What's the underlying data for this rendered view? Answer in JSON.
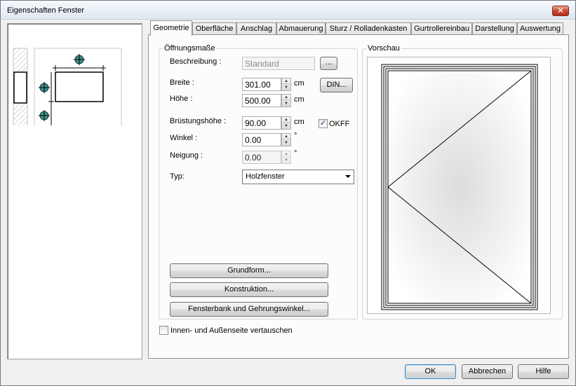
{
  "window": {
    "title": "Eigenschaften Fenster",
    "close_glyph": "✕"
  },
  "tabs": [
    {
      "label": "Geometrie",
      "active": true
    },
    {
      "label": "Oberfläche"
    },
    {
      "label": "Anschlag"
    },
    {
      "label": "Abmauerung"
    },
    {
      "label": "Sturz / Rolladenkasten"
    },
    {
      "label": "Gurtrollereinbau"
    },
    {
      "label": "Darstellung"
    },
    {
      "label": "Auswertung"
    }
  ],
  "opening": {
    "group_label": "Öffnungsmaße",
    "description_label": "Beschreibung :",
    "description_value": "Standard",
    "browse_button": "...",
    "width_label": "Breite :",
    "width_value": "301.00",
    "width_unit": "cm",
    "din_button": "DIN...",
    "height_label": "Höhe :",
    "height_value": "500.00",
    "height_unit": "cm",
    "sill_label": "Brüstungshöhe :",
    "sill_value": "90.00",
    "sill_unit": "cm",
    "okff_label": "OKFF",
    "okff_checked": true,
    "angle_label": "Winkel :",
    "angle_value": "0.00",
    "angle_unit": "°",
    "tilt_label": "Neigung :",
    "tilt_value": "0.00",
    "tilt_unit": "°",
    "type_label": "Typ:",
    "type_value": "Holzfenster",
    "grundform_button": "Grundform...",
    "konstruktion_button": "Konstruktion...",
    "fensterbank_button": "Fensterbank und Gehrungswinkel..."
  },
  "preview": {
    "label": "Vorschau"
  },
  "swap_sides": {
    "label": "Innen- und Außenseite vertauschen",
    "checked": false
  },
  "footer": {
    "ok": "OK",
    "cancel": "Abbrechen",
    "help": "Hilfe"
  }
}
